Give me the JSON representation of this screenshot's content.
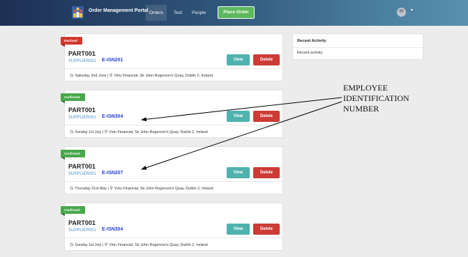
{
  "nav": {
    "brand": "Order Management Portal",
    "links": [
      "Orders",
      "Test",
      "People"
    ],
    "active": "Orders",
    "place_order": "Place Order",
    "logo_icon": "team-logo-icon",
    "avatar_icon": "user-avatar-icon",
    "caret_icon": "chevron-down-icon"
  },
  "orders": [
    {
      "status": "Declined",
      "part": "PART001",
      "supplier": "SUPPLIER001",
      "employee_id": "E-ISN201",
      "view": "View",
      "delete": "Delete",
      "date": "Saturday 2nd June",
      "location": "Virtu Financial, Sir John Rogerson's Quay, Dublin 2, Ireland"
    },
    {
      "status": "Confirmed",
      "part": "PART001",
      "supplier": "SUPPLIER001",
      "employee_id": "E-ISN304",
      "view": "View",
      "delete": "Delete",
      "date": "Sunday 1st July",
      "location": "Virtu Financial, Sir John Rogerson's Quay, Dublin 2, Ireland"
    },
    {
      "status": "Confirmed",
      "part": "PART001",
      "supplier": "SUPPLIER001",
      "employee_id": "E-ISN207",
      "view": "View",
      "delete": "Delete",
      "date": "Thursday 31st May",
      "location": "Virtu Financial, Sir John Rogerson's Quay, Dublin 2, Ireland"
    },
    {
      "status": "Confirmed",
      "part": "PART001",
      "supplier": "SUPPLIER001",
      "employee_id": "E-ISN304",
      "view": "View",
      "delete": "Delete",
      "date": "Sunday 1st July",
      "location": "Virtu Financial, Sir John Rogerson's Quay, Dublin 2, Ireland"
    }
  ],
  "activity": {
    "title": "Recent Activity",
    "text": "Recent activity"
  },
  "annotation": {
    "lines": [
      "EMPLOYEE",
      "IDENTIFICATION",
      "NUMBER"
    ]
  },
  "colors": {
    "declined": "#d0392c",
    "confirmed": "#48a84a",
    "view": "#4fb2ae",
    "delete": "#cc3b35",
    "employee_id": "#2742d9"
  }
}
